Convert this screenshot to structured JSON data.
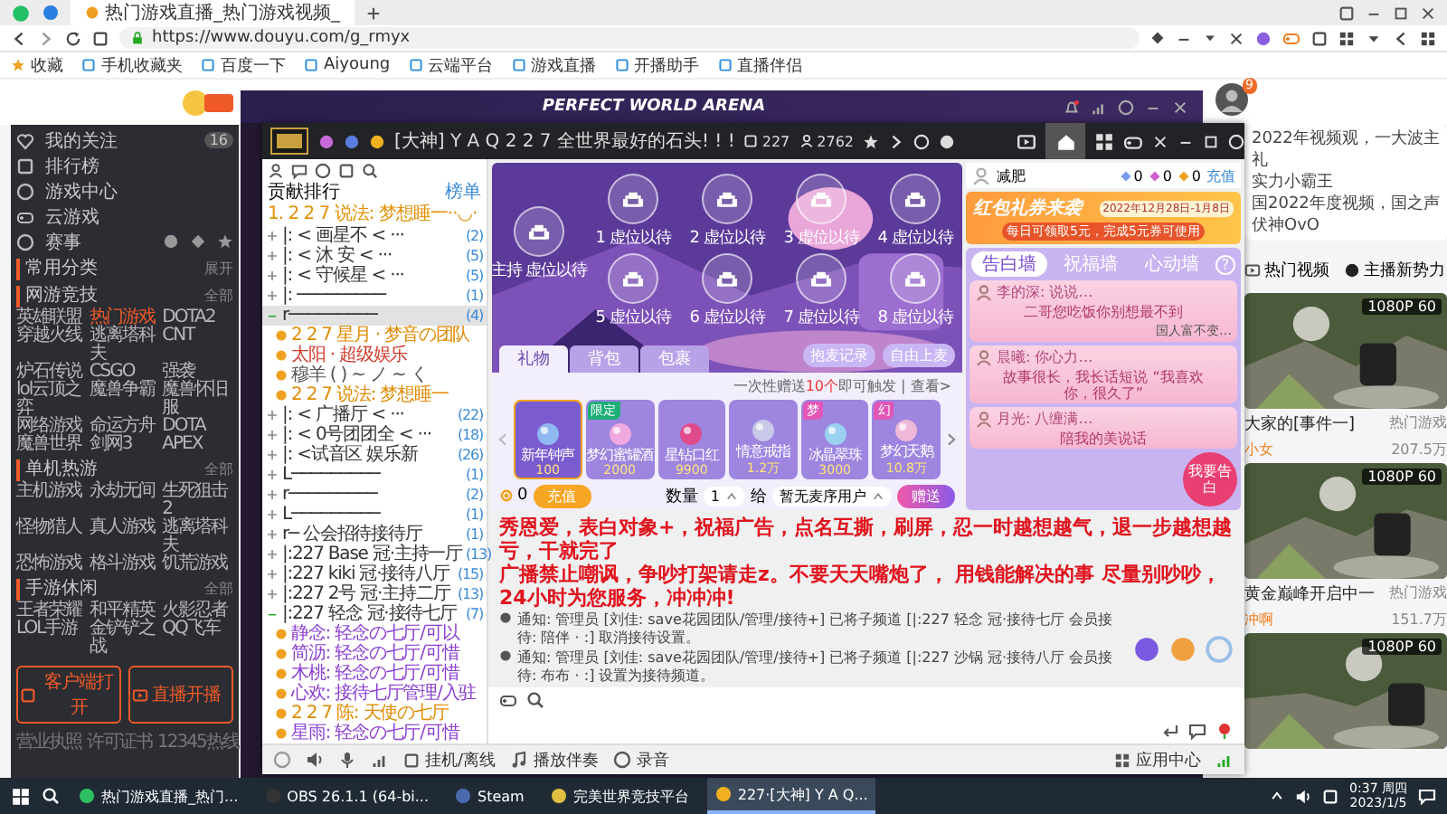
{
  "browser": {
    "tabs": [
      {
        "title": "热门游戏直播_热门游戏视频_",
        "selected": true
      }
    ],
    "url": "https://www.douyu.com/g_rmyx",
    "bookmarks": [
      "收藏",
      "手机收藏夹",
      "百度一下",
      "Aiyoung",
      "云端平台",
      "游戏直播",
      "开播助手",
      "直播伴侣"
    ]
  },
  "site": {
    "nav": [
      {
        "label": "我的关注",
        "badge": "16"
      },
      {
        "label": "排行榜"
      },
      {
        "label": "游戏中心"
      },
      {
        "label": "云游戏"
      }
    ],
    "events_label": "赛事",
    "sections": [
      {
        "title": "常用分类",
        "action": "展开"
      },
      {
        "title": "网游竞技",
        "action": "全部",
        "items": [
          {
            "label": "英雄联盟",
            "selected": false
          },
          {
            "label": "热门游戏",
            "selected": true
          },
          {
            "label": "DOTA2",
            "selected": false
          },
          {
            "label": "穿越火线",
            "selected": false
          },
          {
            "label": "逃离塔科夫",
            "selected": false
          },
          {
            "label": "CNT",
            "selected": false
          },
          {
            "label": "炉石传说",
            "selected": false
          },
          {
            "label": "CSGO",
            "selected": false
          },
          {
            "label": "强袭",
            "selected": false
          },
          {
            "label": "lol云顶之弈",
            "selected": false
          },
          {
            "label": "魔兽争霸",
            "selected": false
          },
          {
            "label": "魔兽怀旧服",
            "selected": false
          },
          {
            "label": "网络游戏",
            "selected": false
          },
          {
            "label": "命运方舟",
            "selected": false
          },
          {
            "label": "DOTA",
            "selected": false
          },
          {
            "label": "魔兽世界",
            "selected": false
          },
          {
            "label": "剑网3",
            "selected": false
          },
          {
            "label": "APEX",
            "selected": false
          }
        ]
      },
      {
        "title": "单机热游",
        "action": "全部",
        "items": [
          {
            "label": "主机游戏",
            "selected": false
          },
          {
            "label": "永劫无间",
            "selected": false
          },
          {
            "label": "生死狙击2",
            "selected": false
          },
          {
            "label": "怪物猎人",
            "selected": false
          },
          {
            "label": "真人游戏",
            "selected": false
          },
          {
            "label": "逃离塔科夫",
            "selected": false
          },
          {
            "label": "恐怖游戏",
            "selected": false
          },
          {
            "label": "格斗游戏",
            "selected": false
          },
          {
            "label": "饥荒游戏",
            "selected": false
          }
        ]
      },
      {
        "title": "手游休闲",
        "action": "全部",
        "items": [
          {
            "label": "王者荣耀",
            "selected": false
          },
          {
            "label": "和平精英",
            "selected": false
          },
          {
            "label": "火影忍者",
            "selected": false
          },
          {
            "label": "LOL手游",
            "selected": false
          },
          {
            "label": "金铲铲之战",
            "selected": false
          },
          {
            "label": "QQ飞车",
            "selected": false
          }
        ]
      }
    ],
    "buttons": [
      "客户端打开",
      "直播开播"
    ],
    "footer": [
      "营业执照",
      "许可证书",
      "12345热线"
    ],
    "avatar_badge": "9",
    "right_card": [
      "2022年视频观，一大波主",
      "礼",
      "实力小霸王",
      "国2022年度视频，国之声",
      "伏神OvO"
    ],
    "right_links": [
      "热门视频",
      "主播新势力"
    ],
    "videos": [
      {
        "quality": "1080P 60",
        "title": "大家的[事件一]",
        "category": "热门游戏",
        "views": "207.5万",
        "author": "小女"
      },
      {
        "quality": "1080P 60",
        "title": "黄金巅峰开启中一",
        "category": "热门游戏",
        "views": "151.7万",
        "author": "冲啊"
      },
      {
        "quality": "1080P 60"
      }
    ]
  },
  "arena": {
    "title": "PERFECT WORLD ARENA"
  },
  "client": {
    "channel_title": "[大神] Y A Q 2 2 7 全世界最好的石头! ! !",
    "channel_id": "227",
    "online": "2762",
    "rank_header": {
      "title": "贡献排行",
      "link": "榜单"
    },
    "ranking": [
      "1. 2 2 7 说法: 梦想睡一··◡·"
    ],
    "tree": [
      {
        "text": "|: < 画星不 < ···",
        "count": "(2)",
        "expanded": false,
        "selected": false
      },
      {
        "text": "|: < 沐 安 < ···",
        "count": "(5)",
        "expanded": false,
        "selected": false
      },
      {
        "text": "|: < 守候星 < ···",
        "count": "(5)",
        "expanded": false,
        "selected": false
      },
      {
        "text": "|: ─────────",
        "count": "(1)",
        "expanded": false,
        "selected": false
      },
      {
        "text": "r─────────",
        "count": "(4)",
        "expanded": true,
        "selected": true,
        "children": [
          {
            "text": "2 2 7 星月 · 梦音の团队",
            "color": "#e08a00"
          },
          {
            "text": "太阳 · 超级娱乐",
            "color": "#d23b2c"
          },
          {
            "text": "穆羊 ( ) ~ ノ ~ く",
            "color": "#555555"
          },
          {
            "text": "2 2 7 说法: 梦想睡一",
            "color": "#e08a00"
          }
        ]
      },
      {
        "text": "|: < 广播厅 < ···",
        "count": "(22)",
        "expanded": false,
        "selected": false
      },
      {
        "text": "|: < 0号团团全 < ···",
        "count": "(18)",
        "expanded": false,
        "selected": false
      },
      {
        "text": "|: <试音区 娱乐新",
        "count": "(26)",
        "expanded": false,
        "selected": false
      },
      {
        "text": "L─────────",
        "count": "(1)",
        "expanded": false,
        "selected": false
      },
      {
        "text": "r─────────",
        "count": "(2)",
        "expanded": false,
        "selected": false
      },
      {
        "text": "L─────────",
        "count": "(1)",
        "expanded": false,
        "selected": false
      },
      {
        "text": "r─ 公会招待接待厅",
        "count": "(1)",
        "expanded": false,
        "selected": false
      },
      {
        "text": "|:227 Base 冠·主持一厅",
        "count": "(13)",
        "expanded": false,
        "selected": false
      },
      {
        "text": "|:227 kiki 冠·接待八厅",
        "count": "(15)",
        "expanded": false,
        "selected": false
      },
      {
        "text": "|:227 2号 冠·主持二厅",
        "count": "(13)",
        "expanded": false,
        "selected": false
      },
      {
        "text": "|:227 轻念 冠·接待七厅",
        "count": "(7)",
        "expanded": true,
        "selected": false,
        "children": [
          {
            "text": "静念: 轻念の七厅/可以",
            "color": "#8a3fd1"
          },
          {
            "text": "简沥: 轻念の七厅/可惜",
            "color": "#8a3fd1"
          },
          {
            "text": "木桃: 轻念の七厅/可惜",
            "color": "#8a3fd1"
          },
          {
            "text": "心欢: 接待七厅管理/入驻",
            "color": "#8a3fd1"
          },
          {
            "text": "2 2 7 陈: 天使の七厅",
            "color": "#e08a00"
          },
          {
            "text": "星雨: 轻念の七厅/可惜",
            "color": "#8a3fd1"
          }
        ]
      }
    ],
    "host_seat": "主持 虚位以待",
    "seats": [
      "1 虚位以待",
      "2 虚位以待",
      "3 虚位以待",
      "4 虚位以待",
      "5 虚位以待",
      "6 虚位以待",
      "7 虚位以待",
      "8 虚位以待"
    ],
    "seat_buttons": [
      "抱麦记录",
      "自由上麦"
    ],
    "gift_tabs": [
      {
        "label": "礼物",
        "selected": true
      },
      {
        "label": "背包",
        "selected": false
      },
      {
        "label": "包裹",
        "selected": false
      }
    ],
    "gift_hint": "一次性赠送**10个**即可触发 | 查看>",
    "gifts": [
      {
        "name": "新年钟声",
        "price": "100",
        "selected": true
      },
      {
        "name": "梦幻蜜罐酒",
        "price": "2000",
        "selected": false,
        "tag": {
          "text": "限定",
          "color": "#1fae78"
        }
      },
      {
        "name": "星钻口红",
        "price": "9900",
        "selected": false
      },
      {
        "name": "情意戒指",
        "price": "1.2万",
        "selected": false
      },
      {
        "name": "冰晶翠珠",
        "price": "3000",
        "selected": false,
        "tag": {
          "text": "梦",
          "color": "#e455b8"
        }
      },
      {
        "name": "梦幻天鹅",
        "price": "10.8万",
        "selected": false,
        "tag": {
          "text": "幻",
          "color": "#e455b8"
        }
      }
    ],
    "balance": "0",
    "recharge": "充值",
    "qty_label": "数量",
    "qty": "1",
    "to_label": "给",
    "recipient": "暂无麦序用户",
    "send": "赠送",
    "user": {
      "name": "减肥",
      "counts": [
        "0",
        "0",
        "0"
      ],
      "link": "充值"
    },
    "banner": {
      "title": "红包礼券来袭",
      "date": "2022年12月28日-1月8日",
      "sub": "每日可领取5元，完成5元券可使用"
    },
    "wall_tabs": [
      {
        "label": "告白墙",
        "selected": true
      },
      {
        "label": "祝福墙",
        "selected": false
      },
      {
        "label": "心动墙",
        "selected": false
      }
    ],
    "help": "?",
    "wall_cards": [
      {
        "from": "李的深: 说说…",
        "message": "二哥您吃饭你别想最不到",
        "sign": "国人富不变…"
      },
      {
        "from": "晨曦: 你心力…",
        "message": "故事很长，我长话短说 “我喜欢你，很久了”"
      },
      {
        "from": "月光: 八缠满…",
        "message": "陪我的美说话"
      }
    ],
    "confess": "我要告白",
    "announcement": [
      "秀恩爱，表白对象+，祝福广告，点名互撕，刷屏，忍一时越想越气，退一步越想越亏，干就完了",
      "广播禁止嘲讽，争吵打架请走z。不要天天嘴炮了， 用钱能解决的事 尽量别吵吵，24小时为您服务，冲冲冲!"
    ],
    "notices": [
      "通知: 管理员 [刘佳: save花园团队/管理/接待+] 已将子频道 [|:227 轻念 冠·接待七厅 会员接待: 陪伴 · :] 取消接待设置。",
      "通知: 管理员 [刘佳: save花园团队/管理/接待+] 已将子频道 [|:227 沙锅 冠·接待八厅 会员接待: 布布 · :] 设置为接待频道。"
    ],
    "bottom_left": "挂机/离线",
    "bottom_tools": [
      "播放伴奏",
      "录音"
    ],
    "app_center": "应用中心"
  },
  "taskbar": {
    "apps": [
      {
        "label": "热门游戏直播_热门...",
        "active": false
      },
      {
        "label": "OBS 26.1.1 (64-bi...",
        "active": false
      },
      {
        "label": "Steam",
        "active": false
      },
      {
        "label": "完美世界竞技平台",
        "active": false
      },
      {
        "label": "227·[大神] Y A Q...",
        "active": true
      }
    ],
    "time": "0:37 周四",
    "date": "2023/1/5"
  }
}
